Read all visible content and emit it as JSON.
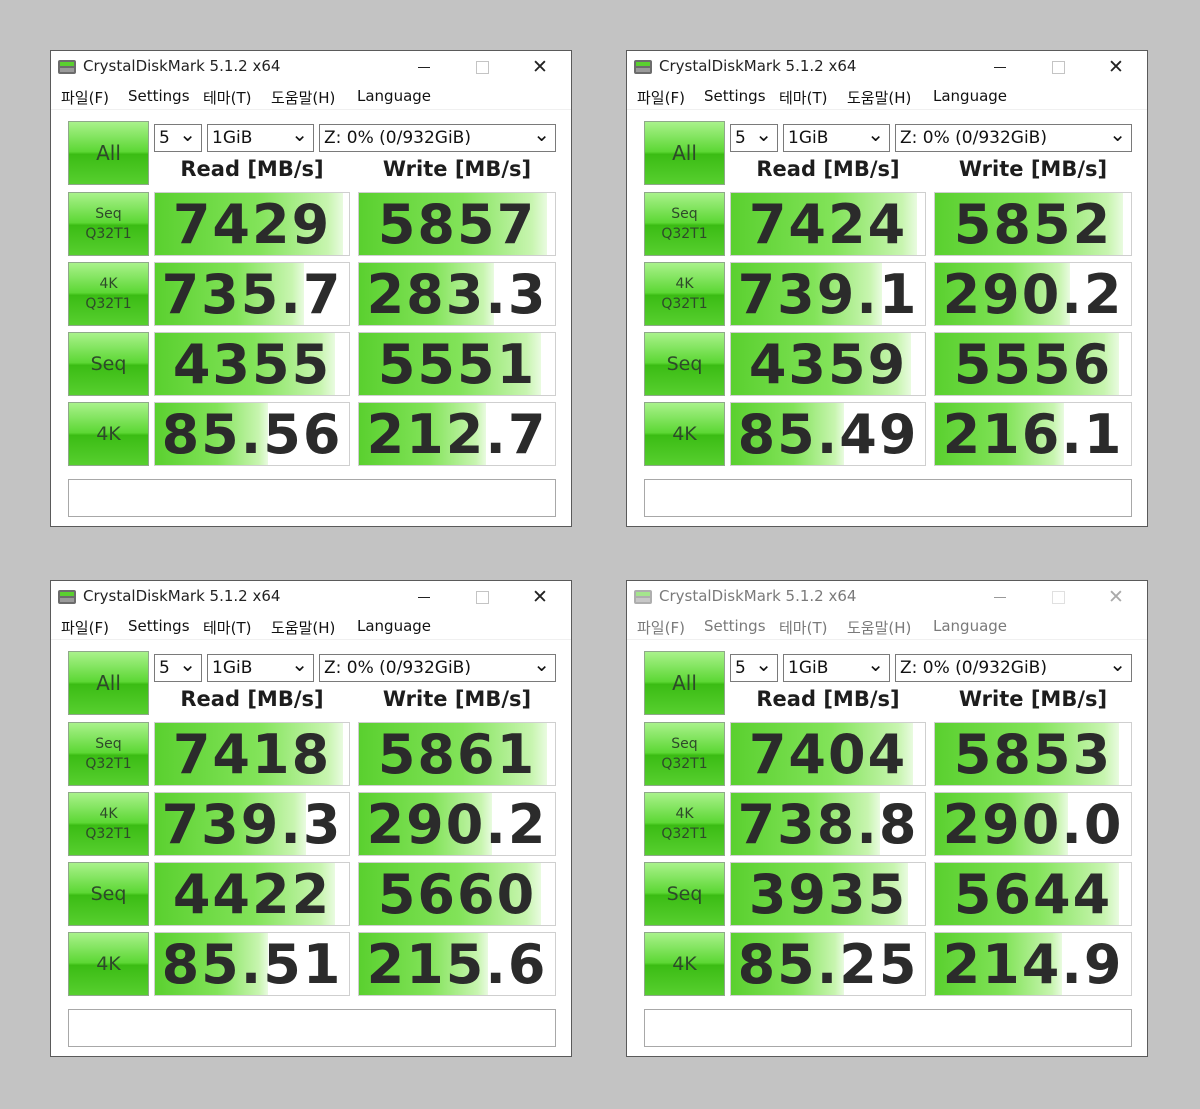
{
  "app": {
    "title": "CrystalDiskMark 5.1.2 x64",
    "menu": [
      "파일(F)",
      "Settings",
      "테마(T)",
      "도움말(H)",
      "Language"
    ],
    "controls": {
      "minimize": "minimize-icon",
      "maximize": "maximize-icon",
      "close": "✕"
    }
  },
  "common": {
    "all_label": "All",
    "count_value": "5",
    "size_value": "1GiB",
    "drive_value": "Z: 0% (0/932GiB)",
    "read_header": "Read [MB/s]",
    "write_header": "Write [MB/s]",
    "tests": [
      {
        "line1": "Seq",
        "line2": "Q32T1"
      },
      {
        "line1": "4K",
        "line2": "Q32T1"
      },
      {
        "line1": "Seq",
        "line2": ""
      },
      {
        "line1": "4K",
        "line2": ""
      }
    ]
  },
  "colors": {
    "bar_green": "#5ad02f",
    "button_green": "#5cd734",
    "background": "#c3c3c3"
  },
  "windows": [
    {
      "state": "active",
      "results": [
        {
          "read": "7429",
          "write": "5857",
          "read_fill": 0.97,
          "write_fill": 0.96
        },
        {
          "read": "735.7",
          "write": "283.3",
          "read_fill": 0.77,
          "write_fill": 0.69
        },
        {
          "read": "4355",
          "write": "5551",
          "read_fill": 0.93,
          "write_fill": 0.93
        },
        {
          "read": "85.56",
          "write": "212.7",
          "read_fill": 0.58,
          "write_fill": 0.65
        }
      ]
    },
    {
      "state": "active",
      "results": [
        {
          "read": "7424",
          "write": "5852",
          "read_fill": 0.96,
          "write_fill": 0.96
        },
        {
          "read": "739.1",
          "write": "290.2",
          "read_fill": 0.78,
          "write_fill": 0.69
        },
        {
          "read": "4359",
          "write": "5556",
          "read_fill": 0.93,
          "write_fill": 0.94
        },
        {
          "read": "85.49",
          "write": "216.1",
          "read_fill": 0.58,
          "write_fill": 0.66
        }
      ]
    },
    {
      "state": "active",
      "results": [
        {
          "read": "7418",
          "write": "5861",
          "read_fill": 0.97,
          "write_fill": 0.96
        },
        {
          "read": "739.3",
          "write": "290.2",
          "read_fill": 0.78,
          "write_fill": 0.68
        },
        {
          "read": "4422",
          "write": "5660",
          "read_fill": 0.93,
          "write_fill": 0.93
        },
        {
          "read": "85.51",
          "write": "215.6",
          "read_fill": 0.58,
          "write_fill": 0.66
        }
      ]
    },
    {
      "state": "inactive",
      "results": [
        {
          "read": "7404",
          "write": "5853",
          "read_fill": 0.94,
          "write_fill": 0.94
        },
        {
          "read": "738.8",
          "write": "290.0",
          "read_fill": 0.77,
          "write_fill": 0.68
        },
        {
          "read": "3935",
          "write": "5644",
          "read_fill": 0.91,
          "write_fill": 0.94
        },
        {
          "read": "85.25",
          "write": "214.9",
          "read_fill": 0.58,
          "write_fill": 0.65
        }
      ]
    }
  ]
}
